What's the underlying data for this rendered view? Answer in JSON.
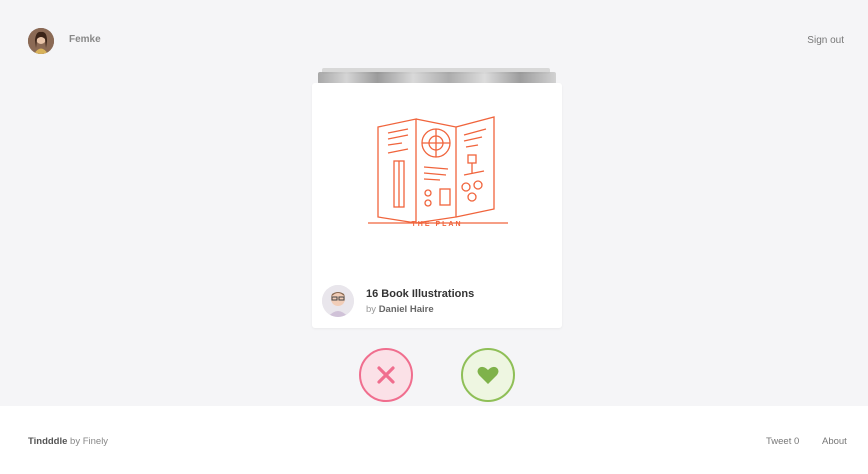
{
  "user": {
    "name": "Femke",
    "avatar_icon": "user-avatar"
  },
  "header": {
    "signout_label": "Sign out"
  },
  "card": {
    "image_caption": "THE PLAN",
    "title": "16 Book Illustrations",
    "by_prefix": "by",
    "author": "Daniel Haire",
    "accent_color": "#f0643c"
  },
  "actions": {
    "nope_icon": "close-icon",
    "nope_color": "#f06e8e",
    "like_icon": "heart-icon",
    "like_color": "#8fbf57"
  },
  "footer": {
    "brand": "Tindddle",
    "by_text": "by Finely",
    "tweet_label": "Tweet",
    "tweet_count": "0",
    "about_label": "About"
  }
}
